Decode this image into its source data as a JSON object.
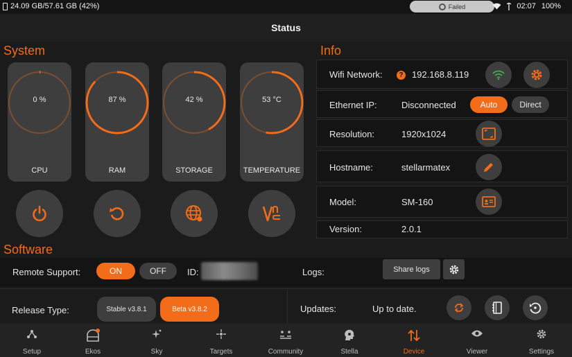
{
  "statusbar": {
    "storage": "24.09 GB/57.61 GB (42%)",
    "connection_status": "Failed",
    "time": "02:07",
    "battery": "100%"
  },
  "appbar": {
    "title": "Status"
  },
  "system": {
    "title": "System",
    "gauges": [
      {
        "label": "CPU",
        "value_text": "0 %",
        "fraction": 0.0
      },
      {
        "label": "RAM",
        "value_text": "87 %",
        "fraction": 0.87
      },
      {
        "label": "STORAGE",
        "value_text": "42 %",
        "fraction": 0.42
      },
      {
        "label": "TEMPERATURE",
        "value_text": "53 °C",
        "fraction": 0.53
      }
    ],
    "actions": [
      "power-icon",
      "restart-icon",
      "language-icon",
      "vnc-icon"
    ]
  },
  "info": {
    "title": "Info",
    "wifi_label": "Wifi Network:",
    "wifi_value": "192.168.8.119",
    "ethernet_label": "Ethernet IP:",
    "ethernet_value": "Disconnected",
    "ethernet_auto": "Auto",
    "ethernet_direct": "Direct",
    "resolution_label": "Resolution:",
    "resolution_value": "1920x1024",
    "hostname_label": "Hostname:",
    "hostname_value": "stellarmatex",
    "model_label": "Model:",
    "model_value": "SM-160",
    "version_label": "Version:",
    "version_value": "2.0.1"
  },
  "software": {
    "title": "Software",
    "remote_support_label": "Remote Support:",
    "on_label": "ON",
    "off_label": "OFF",
    "id_label": "ID:",
    "logs_label": "Logs:",
    "share_logs": "Share logs",
    "release_type_label": "Release Type:",
    "stable_label": "Stable v3.8.1",
    "beta_label": "Beta v3.8.2",
    "updates_label": "Updates:",
    "updates_status": "Up to date."
  },
  "nav": [
    {
      "label": "Setup",
      "icon": "setup-icon"
    },
    {
      "label": "Ekos",
      "icon": "ekos-icon"
    },
    {
      "label": "Sky",
      "icon": "sky-icon"
    },
    {
      "label": "Targets",
      "icon": "targets-icon"
    },
    {
      "label": "Community",
      "icon": "community-icon"
    },
    {
      "label": "Stella",
      "icon": "stella-icon"
    },
    {
      "label": "Device",
      "icon": "device-icon"
    },
    {
      "label": "Viewer",
      "icon": "viewer-icon"
    },
    {
      "label": "Settings",
      "icon": "settings-icon"
    }
  ],
  "colors": {
    "accent": "#f26c1a",
    "card": "#3e3e3e",
    "background": "#1b1b1b"
  }
}
